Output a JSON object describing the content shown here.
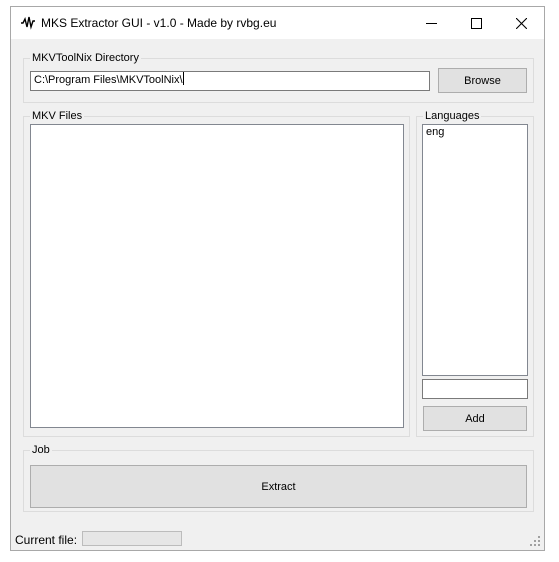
{
  "window": {
    "title": "MKS Extractor GUI - v1.0 - Made by rvbg.eu",
    "icon": "app-icon"
  },
  "mkvtoolnix": {
    "group_label": "MKVToolNix Directory",
    "path_value": "C:\\Program Files\\MKVToolNix\\",
    "browse_label": "Browse"
  },
  "mkv_files": {
    "group_label": "MKV Files",
    "items": []
  },
  "languages": {
    "group_label": "Languages",
    "items": [
      "eng"
    ],
    "new_language_value": "",
    "add_label": "Add"
  },
  "job": {
    "group_label": "Job",
    "extract_label": "Extract"
  },
  "status": {
    "current_file_label": "Current file:",
    "progress": 0
  }
}
